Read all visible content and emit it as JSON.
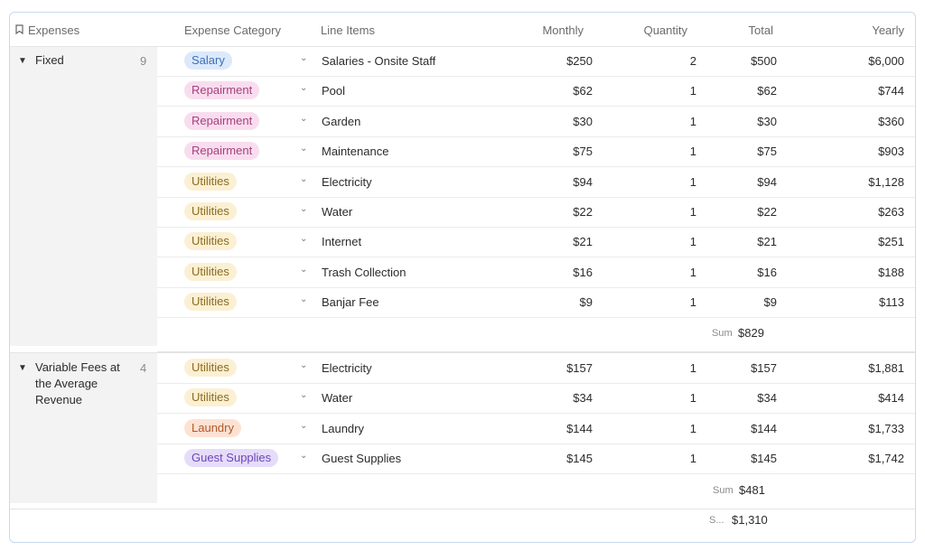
{
  "header": {
    "expenses": "Expenses",
    "category": "Expense Category",
    "line_items": "Line Items",
    "monthly": "Monthly",
    "quantity": "Quantity",
    "total": "Total",
    "yearly": "Yearly"
  },
  "groups": [
    {
      "name": "Fixed",
      "count": "9",
      "sum_label": "Sum",
      "sum_value": "$829",
      "rows": [
        {
          "category": "Salary",
          "item": "Salaries - Onsite Staff",
          "monthly": "$250",
          "quantity": "2",
          "total": "$500",
          "yearly": "$6,000"
        },
        {
          "category": "Repairment",
          "item": "Pool",
          "monthly": "$62",
          "quantity": "1",
          "total": "$62",
          "yearly": "$744"
        },
        {
          "category": "Repairment",
          "item": "Garden",
          "monthly": "$30",
          "quantity": "1",
          "total": "$30",
          "yearly": "$360"
        },
        {
          "category": "Repairment",
          "item": "Maintenance",
          "monthly": "$75",
          "quantity": "1",
          "total": "$75",
          "yearly": "$903"
        },
        {
          "category": "Utilities",
          "item": "Electricity",
          "monthly": "$94",
          "quantity": "1",
          "total": "$94",
          "yearly": "$1,128"
        },
        {
          "category": "Utilities",
          "item": "Water",
          "monthly": "$22",
          "quantity": "1",
          "total": "$22",
          "yearly": "$263"
        },
        {
          "category": "Utilities",
          "item": "Internet",
          "monthly": "$21",
          "quantity": "1",
          "total": "$21",
          "yearly": "$251"
        },
        {
          "category": "Utilities",
          "item": "Trash Collection",
          "monthly": "$16",
          "quantity": "1",
          "total": "$16",
          "yearly": "$188"
        },
        {
          "category": "Utilities",
          "item": "Banjar Fee",
          "monthly": "$9",
          "quantity": "1",
          "total": "$9",
          "yearly": "$113"
        }
      ]
    },
    {
      "name": "Variable Fees at the Average Revenue",
      "count": "4",
      "sum_label": "Sum",
      "sum_value": "$481",
      "rows": [
        {
          "category": "Utilities",
          "item": "Electricity",
          "monthly": "$157",
          "quantity": "1",
          "total": "$157",
          "yearly": "$1,881"
        },
        {
          "category": "Utilities",
          "item": "Water",
          "monthly": "$34",
          "quantity": "1",
          "total": "$34",
          "yearly": "$414"
        },
        {
          "category": "Laundry",
          "item": "Laundry",
          "monthly": "$144",
          "quantity": "1",
          "total": "$144",
          "yearly": "$1,733"
        },
        {
          "category": "Guest Supplies",
          "item": "Guest Supplies",
          "monthly": "$145",
          "quantity": "1",
          "total": "$145",
          "yearly": "$1,742"
        }
      ]
    }
  ],
  "grand_total": {
    "label": "S...",
    "value": "$1,310"
  },
  "category_colors": {
    "Salary": {
      "bg": "#dbe9fb",
      "fg": "#3f6fb5"
    },
    "Repairment": {
      "bg": "#f8ddef",
      "fg": "#a8407f"
    },
    "Utilities": {
      "bg": "#fbf0d3",
      "fg": "#8c6b1f"
    },
    "Laundry": {
      "bg": "#fde2d3",
      "fg": "#b2582b"
    },
    "Guest Supplies": {
      "bg": "#e6dcfa",
      "fg": "#6b45b8"
    }
  }
}
